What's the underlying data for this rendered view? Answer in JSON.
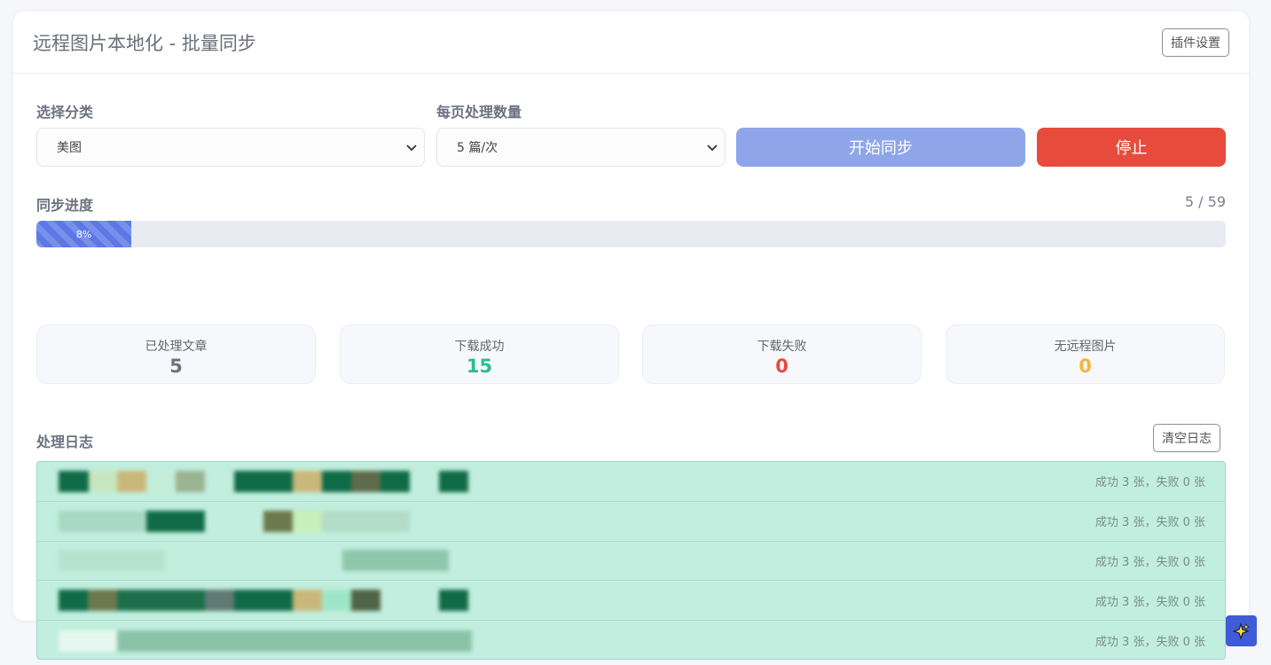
{
  "header": {
    "title": "远程图片本地化 - 批量同步",
    "settings_label": "插件设置"
  },
  "controls": {
    "category_label": "选择分类",
    "category_value": "美图",
    "per_page_label": "每页处理数量",
    "per_page_value": "5 篇/次",
    "start_label": "开始同步",
    "stop_label": "停止"
  },
  "progress": {
    "label": "同步进度",
    "count_text": "5 / 59",
    "percent": 8,
    "percent_text": "8%"
  },
  "stats": [
    {
      "label": "已处理文章",
      "value": "5",
      "color": "#6d7280"
    },
    {
      "label": "下载成功",
      "value": "15",
      "color": "#2bbf8a"
    },
    {
      "label": "下载失败",
      "value": "0",
      "color": "#e74b3c"
    },
    {
      "label": "无远程图片",
      "value": "0",
      "color": "#f3b73c"
    }
  ],
  "log": {
    "label": "处理日志",
    "clear_label": "清空日志",
    "entries": [
      {
        "title": "",
        "result": "成功 3 张，失败 0 张"
      },
      {
        "title": "",
        "result": "成功 3 张，失败 0 张"
      },
      {
        "title": "",
        "result": "成功 3 张，失败 0 张"
      },
      {
        "title": "",
        "result": "成功 3 张，失败 0 张"
      },
      {
        "title": "",
        "result": "成功 3 张，失败 0 张"
      }
    ]
  },
  "colors": {
    "accent": "#5b78e6",
    "start_button": "#8ea6e9",
    "stop_button": "#e74b3c",
    "log_background": "#c1eede"
  },
  "icons": {
    "select_chevron": "chevron-down-icon",
    "fab": "sparkle-icon"
  }
}
